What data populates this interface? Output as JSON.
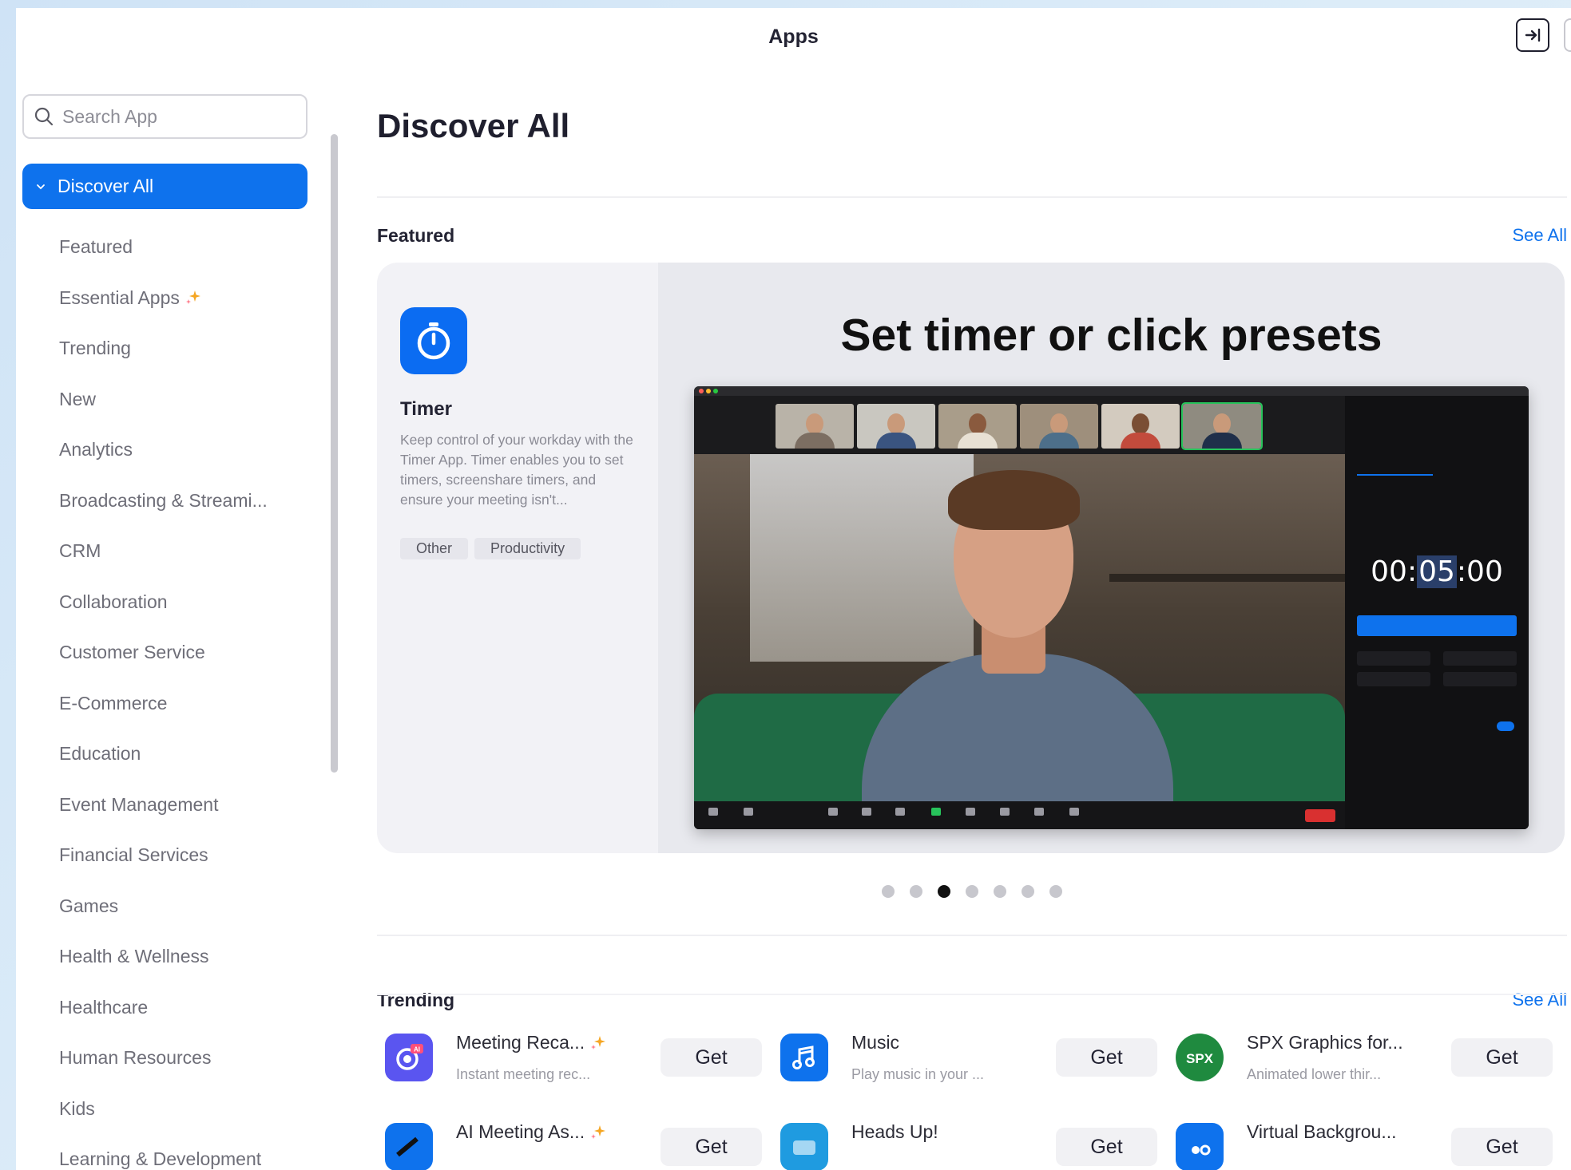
{
  "window": {
    "title": "Apps"
  },
  "search": {
    "placeholder": "Search App"
  },
  "sidebar": {
    "active": "Discover All",
    "items": [
      {
        "label": "Featured"
      },
      {
        "label": "Essential Apps",
        "sparkle": true
      },
      {
        "label": "Trending"
      },
      {
        "label": "New"
      },
      {
        "label": "Analytics"
      },
      {
        "label": "Broadcasting & Streami..."
      },
      {
        "label": "CRM"
      },
      {
        "label": "Collaboration"
      },
      {
        "label": "Customer Service"
      },
      {
        "label": "E-Commerce"
      },
      {
        "label": "Education"
      },
      {
        "label": "Event Management"
      },
      {
        "label": "Financial Services"
      },
      {
        "label": "Games"
      },
      {
        "label": "Health & Wellness"
      },
      {
        "label": "Healthcare"
      },
      {
        "label": "Human Resources"
      },
      {
        "label": "Kids"
      },
      {
        "label": "Learning & Development"
      }
    ]
  },
  "main": {
    "page_title": "Discover All",
    "featured": {
      "section_title": "Featured",
      "see_all": "See All",
      "app": {
        "name": "Timer",
        "icon": "stopwatch-icon",
        "description": "Keep control of your workday with the Timer App. Timer enables you to set timers, screenshare timers, and ensure your meeting isn't...",
        "tags": [
          "Other",
          "Productivity"
        ]
      },
      "promo_title": "Set timer or click presets",
      "timer_display": {
        "hours": "00",
        "minutes": "05",
        "seconds": "00"
      },
      "pagination": {
        "count": 7,
        "active_index": 2
      }
    },
    "trending": {
      "section_title": "Trending",
      "see_all": "See All",
      "get_label": "Get",
      "apps": [
        {
          "name": "Meeting Reca...",
          "desc": "Instant meeting rec...",
          "icon": "ai-companion-icon",
          "color": "#5a55f0",
          "sparkle": true
        },
        {
          "name": "Music",
          "desc": "Play music in your ...",
          "icon": "music-icon",
          "color": "#0e72ed",
          "sparkle": false
        },
        {
          "name": "SPX Graphics for...",
          "desc": "Animated lower thir...",
          "icon": "spx-icon",
          "color": "#1f8a3f",
          "sparkle": false
        },
        {
          "name": "AI Meeting As...",
          "desc": "",
          "icon": "ai-meeting-icon",
          "color": "#0e72ed",
          "sparkle": true
        },
        {
          "name": "Heads Up!",
          "desc": "",
          "icon": "heads-up-icon",
          "color": "#1f9be0",
          "sparkle": false
        },
        {
          "name": "Virtual Backgrou...",
          "desc": "",
          "icon": "virtual-background-icon",
          "color": "#0e72ed",
          "sparkle": false
        }
      ]
    }
  }
}
